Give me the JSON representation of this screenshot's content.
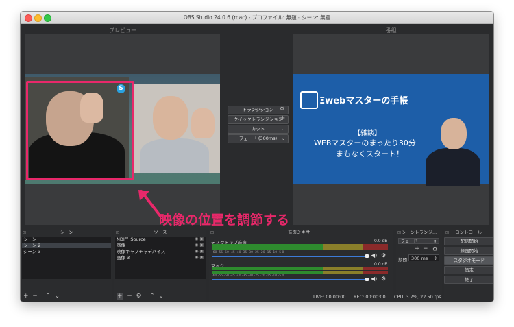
{
  "window": {
    "title": "OBS Studio 24.0.6 (mac) - プロファイル: 無題 - シーン: 無題"
  },
  "preview": {
    "label": "プレビュー"
  },
  "program": {
    "label": "番組",
    "logo_text": "Ξwebマスターの手帳",
    "line1": "【雑談】",
    "line2": "WEBマスターのまったり30分",
    "line3": "まもなくスタート！"
  },
  "transition_panel": {
    "transition_btn": "トランジション",
    "quick_btn": "クイックトランジション",
    "cut_btn": "カット",
    "fade_btn": "フェード (300ms)"
  },
  "annotation": {
    "text": "映像の位置を調節する"
  },
  "scenes": {
    "title": "シーン",
    "items": [
      "シーン",
      "シーン 2",
      "シーン 3"
    ],
    "selected": 1
  },
  "sources": {
    "title": "ソース",
    "items": [
      "NDI™ Source",
      "画像",
      "映像キャプチャデバイス",
      "画像 3"
    ]
  },
  "mixer": {
    "title": "音声ミキサー",
    "tracks": [
      {
        "name": "デスクトップ音声",
        "db": "0.0 dB"
      },
      {
        "name": "マイク",
        "db": "0.0 dB"
      }
    ],
    "scale": "-60  -55  -50  -45  -40  -35  -30  -25  -20  -15  -10  -5  0"
  },
  "scene_transitions": {
    "title": "シーントランジ...",
    "type": "フェード",
    "duration_label": "期間",
    "duration_value": "300 ms"
  },
  "controls": {
    "title": "コントロール",
    "buttons": [
      "配信開始",
      "録画開始",
      "スタジオモード",
      "設定",
      "終了"
    ]
  },
  "status": {
    "live": "LIVE: 00:00:00",
    "rec": "REC: 00:00:00",
    "cpu": "CPU: 3.7%, 22.50 fps"
  },
  "colors": {
    "accent": "#e8286a",
    "program_bg": "#1d5ea8"
  }
}
